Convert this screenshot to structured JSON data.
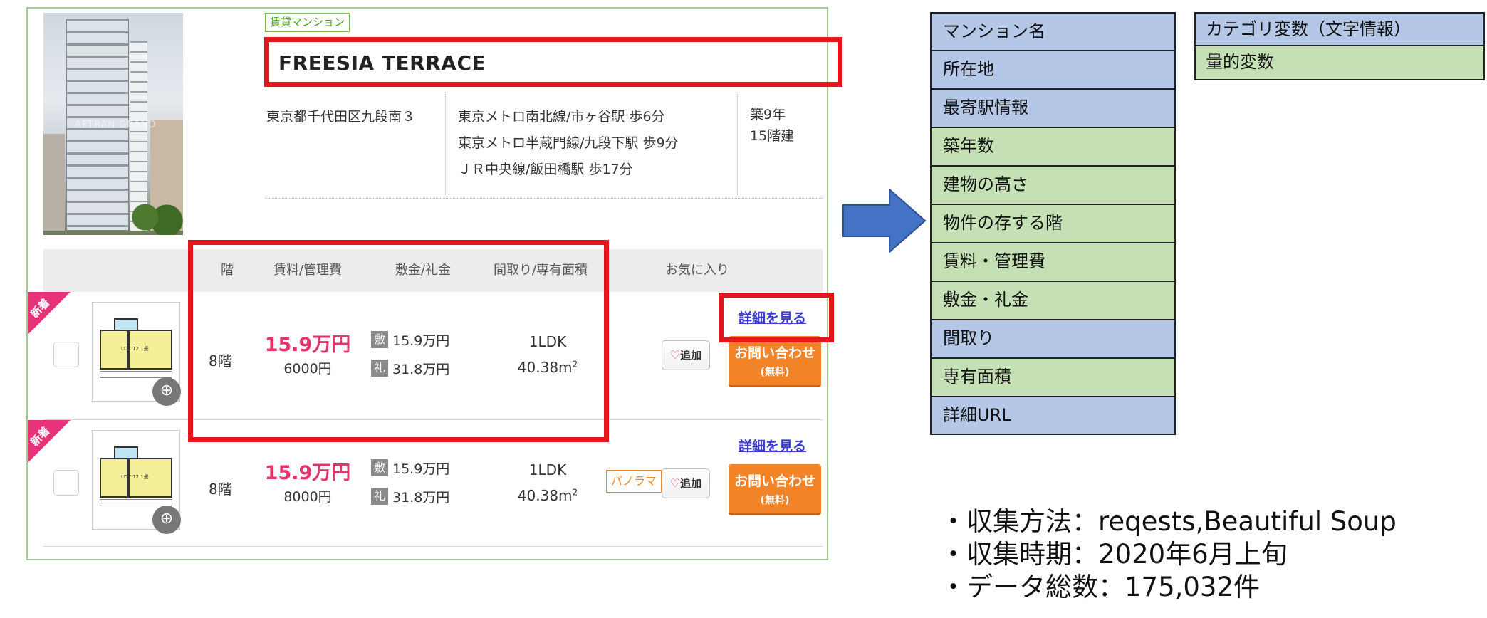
{
  "listing": {
    "property_type": "賃貸マンション",
    "name": "FREESIA TERRACE",
    "address": "東京都千代田区九段南３",
    "stations": [
      "東京メトロ南北線/市ヶ谷駅 歩6分",
      "東京メトロ半蔵門線/九段下駅 歩9分",
      "ＪＲ中央線/飯田橋駅 歩17分"
    ],
    "age": "築9年",
    "height": "15階建",
    "photo_watermark": "AFTRAN GRAND",
    "columns": {
      "floor": "階",
      "rent": "賃料/管理費",
      "deposit": "敷金/礼金",
      "layout": "間取り/専有面積",
      "favorite": "お気に入り"
    },
    "rows": [
      {
        "badge": "新着",
        "floor": "8階",
        "rent": "15.9万円",
        "mgmt_fee": "6000円",
        "deposit_icon": "敷",
        "deposit": "15.9万円",
        "key_money_icon": "礼",
        "key_money": "31.8万円",
        "layout": "1LDK",
        "area": "40.38m",
        "area_sup": "2",
        "panorama": "",
        "add_label": "追加",
        "detail_link": "詳細を見る",
        "contact_label": "お問い合わせ",
        "contact_sub": "(無料)",
        "plan_label": "LDK 12.1畳"
      },
      {
        "badge": "新着",
        "floor": "8階",
        "rent": "15.9万円",
        "mgmt_fee": "8000円",
        "deposit_icon": "敷",
        "deposit": "15.9万円",
        "key_money_icon": "礼",
        "key_money": "31.8万円",
        "layout": "1LDK",
        "area": "40.38m",
        "area_sup": "2",
        "panorama": "パノラマ",
        "add_label": "追加",
        "detail_link": "詳細を見る",
        "contact_label": "お問い合わせ",
        "contact_sub": "(無料)",
        "plan_label": "LDK 12.1畳"
      }
    ]
  },
  "variables": [
    {
      "label": "マンション名",
      "kind": "categorical"
    },
    {
      "label": "所在地",
      "kind": "categorical"
    },
    {
      "label": "最寄駅情報",
      "kind": "categorical"
    },
    {
      "label": "築年数",
      "kind": "quantitative"
    },
    {
      "label": "建物の高さ",
      "kind": "quantitative"
    },
    {
      "label": "物件の存する階",
      "kind": "quantitative"
    },
    {
      "label": "賃料・管理費",
      "kind": "quantitative"
    },
    {
      "label": "敷金・礼金",
      "kind": "quantitative"
    },
    {
      "label": "間取り",
      "kind": "categorical"
    },
    {
      "label": "専有面積",
      "kind": "quantitative"
    },
    {
      "label": "詳細URL",
      "kind": "categorical"
    }
  ],
  "legend": {
    "categorical": "カテゴリ変数（文字情報）",
    "quantitative": "量的変数"
  },
  "notes": [
    "・収集方法：reqests,Beautiful Soup",
    "・収集時期：2020年6月上旬",
    "・データ総数：175,032件"
  ],
  "colors": {
    "categorical_fill": "#b4c7e7",
    "quantitative_fill": "#c5e0b4",
    "highlight": "#e4161b",
    "arrow": "#4472c4",
    "price": "#e8336a",
    "contact_button": "#f28327"
  }
}
